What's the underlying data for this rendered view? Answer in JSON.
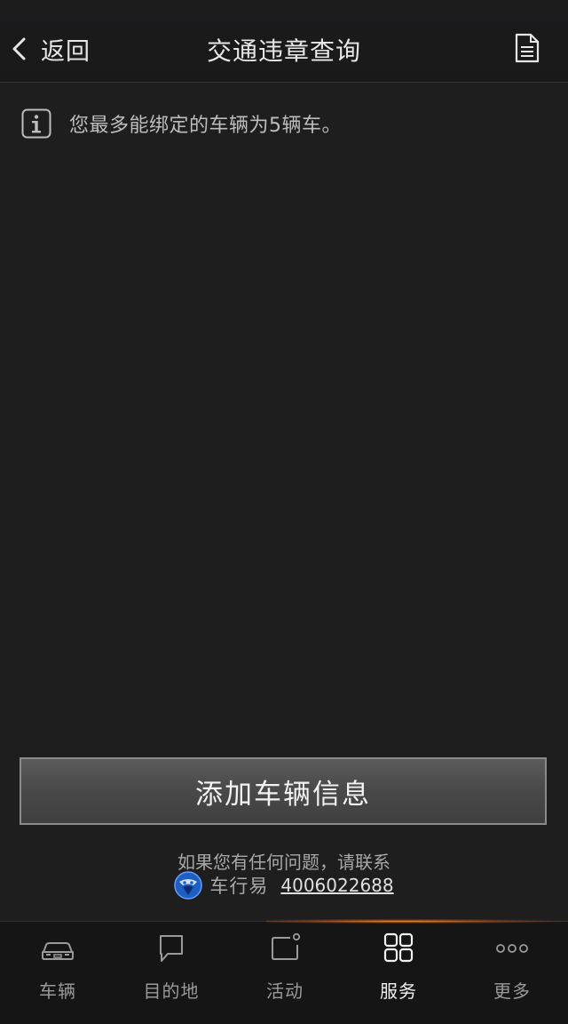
{
  "header": {
    "back_label": "返回",
    "title": "交通违章查询",
    "right_icon": "document-icon"
  },
  "notice": {
    "icon": "info-icon",
    "text": "您最多能绑定的车辆为5辆车。"
  },
  "add_button": {
    "label": "添加车辆信息"
  },
  "contact": {
    "prompt": "如果您有任何问题，请联系",
    "brand_name": "车行易",
    "phone": "4006022688"
  },
  "tabbar": {
    "active": "服务",
    "items": [
      {
        "label": "车辆",
        "icon": "car-icon"
      },
      {
        "label": "目的地",
        "icon": "chat-bubble-icon"
      },
      {
        "label": "活动",
        "icon": "activity-icon"
      },
      {
        "label": "服务",
        "icon": "grid-icon"
      },
      {
        "label": "更多",
        "icon": "more-dots-icon"
      }
    ]
  },
  "colors": {
    "background": "#1e1e1f",
    "button_border": "#8a8a8a",
    "accent_glow": "#ff8c28",
    "text_primary": "#e8e8e8",
    "text_secondary": "#a8a8a8"
  }
}
